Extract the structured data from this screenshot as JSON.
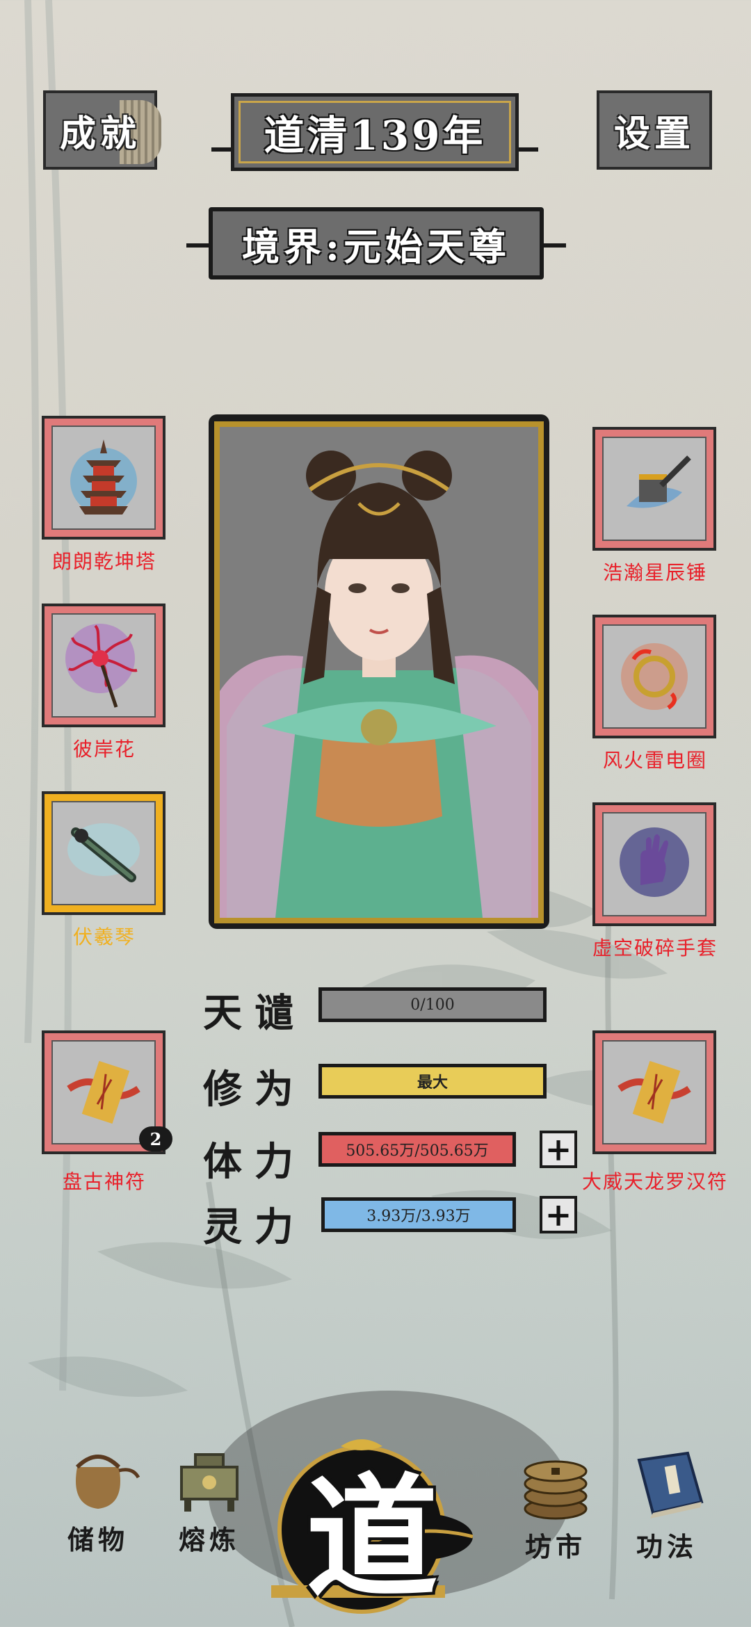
{
  "header": {
    "achievements_label": "成就",
    "year_label": "道清139年",
    "settings_label": "设置",
    "realm_label": "境界:元始天尊"
  },
  "equipment": {
    "left": [
      {
        "name": "朗朗乾坤塔",
        "icon": "pagoda-icon"
      },
      {
        "name": "彼岸花",
        "icon": "spider-lily-icon"
      },
      {
        "name": "伏羲琴",
        "icon": "flute-icon",
        "highlight": true
      }
    ],
    "right": [
      {
        "name": "浩瀚星辰锤",
        "icon": "hammer-icon"
      },
      {
        "name": "风火雷电圈",
        "icon": "ring-icon"
      },
      {
        "name": "虚空破碎手套",
        "icon": "glove-icon"
      }
    ],
    "talisman_left": {
      "name": "盘古神符",
      "icon": "talisman-icon",
      "count": "2"
    },
    "talisman_right": {
      "name": "大威天龙罗汉符",
      "icon": "talisman-icon"
    }
  },
  "stats": {
    "tianqian": {
      "label": "天谴",
      "value": "0/100",
      "fill": 0.0,
      "color": "#8a8a8a"
    },
    "xiuwei": {
      "label": "修为",
      "value": "最大",
      "fill": 1.0,
      "color": "#e8cc58"
    },
    "tili": {
      "label": "体力",
      "value": "505.65万/505.65万",
      "fill": 1.0,
      "color": "#e06060"
    },
    "lingli": {
      "label": "灵力",
      "value": "3.93万/3.93万",
      "fill": 1.0,
      "color": "#7fb8e6"
    }
  },
  "nav": {
    "storage": "储物",
    "refine": "熔炼",
    "dao": "道",
    "market": "坊市",
    "skills": "功法"
  }
}
